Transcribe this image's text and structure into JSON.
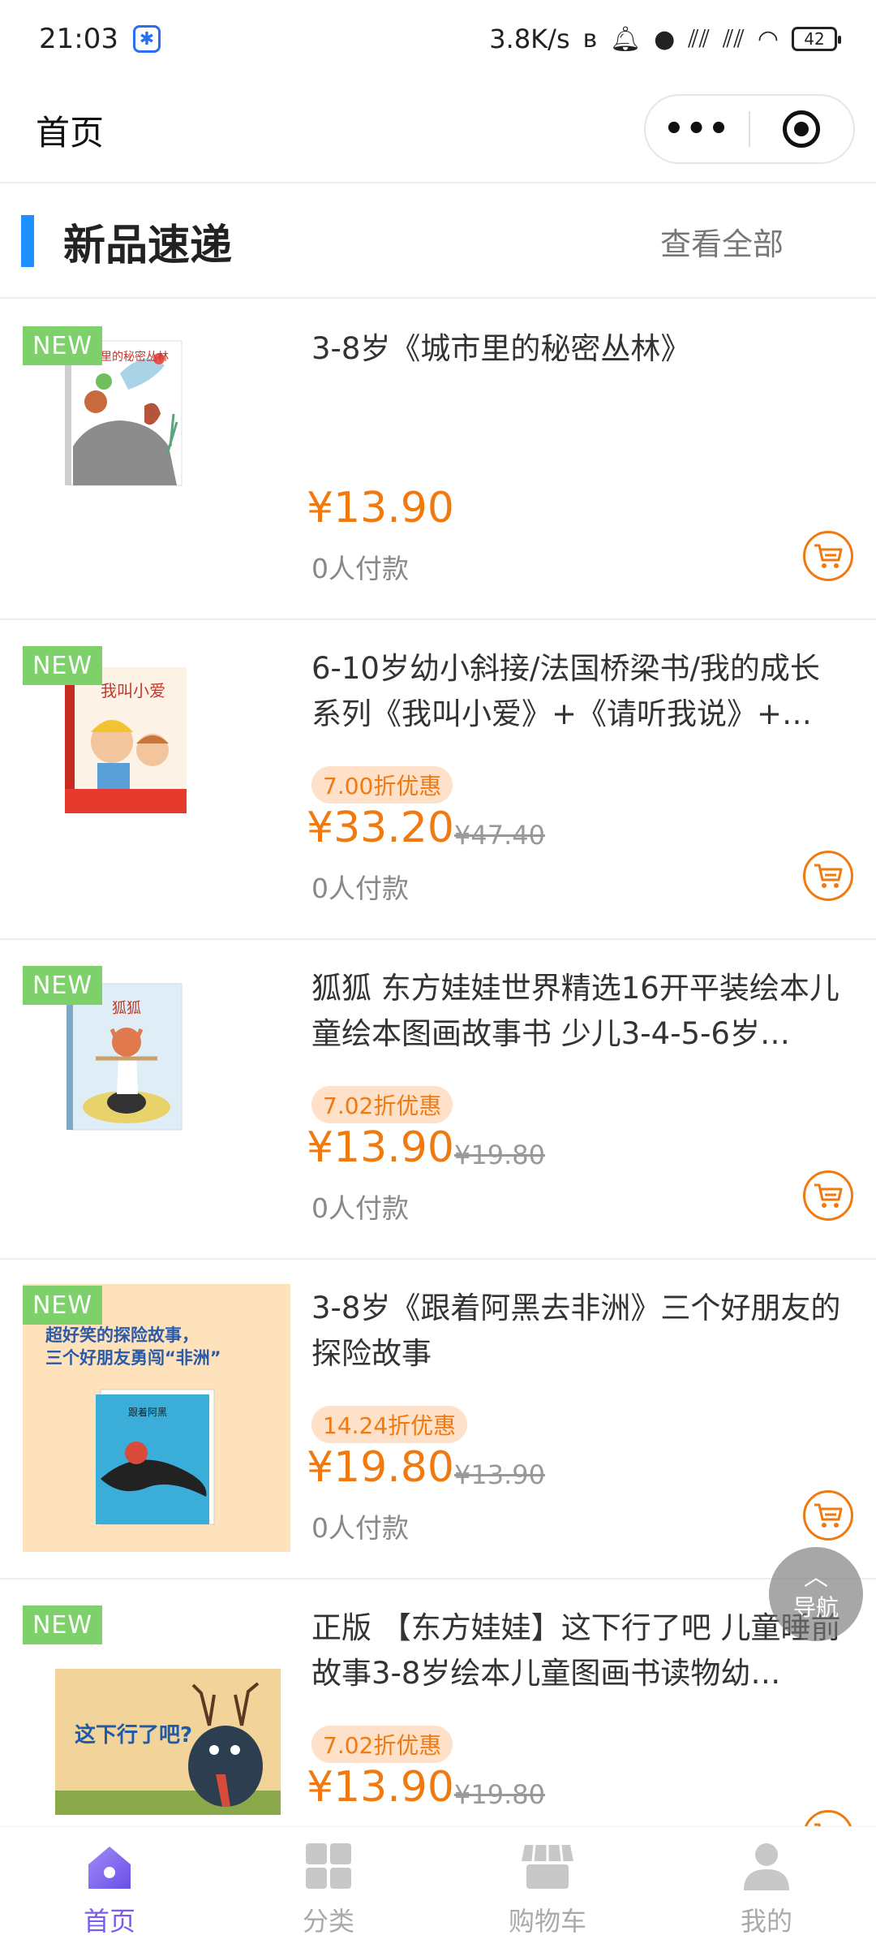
{
  "status_bar": {
    "time": "21:03",
    "app_badge": "✱",
    "network_speed": "3.8K/s",
    "icons": [
      "bluetooth-icon",
      "bell-icon",
      "panda-icon",
      "signal-icon",
      "signal-icon",
      "wifi-icon"
    ],
    "battery": "42"
  },
  "header": {
    "title": "首页",
    "more_label": "•••"
  },
  "section": {
    "heading": "新品速递",
    "view_all": "查看全部"
  },
  "products": [
    {
      "tag": "NEW",
      "name": "3-8岁《城市里的秘密丛林》",
      "discount": "",
      "price": "¥13.90",
      "original_price": "",
      "sold": "0人付款",
      "cover_text": "城市里的秘密丛林"
    },
    {
      "tag": "NEW",
      "name": "6-10岁幼小斜接/法国桥梁书/我的成长系列《我叫小爱》+《请听我说》+…",
      "discount": "7.00折优惠",
      "price": "¥33.20",
      "original_price": "¥47.40",
      "sold": "0人付款",
      "cover_text": "我叫小爱"
    },
    {
      "tag": "NEW",
      "name": "狐狐 东方娃娃世界精选16开平装绘本儿童绘本图画故事书 少儿3-4-5-6岁…",
      "discount": "7.02折优惠",
      "price": "¥13.90",
      "original_price": "¥19.80",
      "sold": "0人付款",
      "cover_text": "狐狐"
    },
    {
      "tag": "NEW",
      "name": "3-8岁《跟着阿黑去非洲》三个好朋友的探险故事",
      "discount": "14.24折优惠",
      "price": "¥19.80",
      "original_price": "¥13.90",
      "sold": "0人付款",
      "cover_text": "超好笑的探险故事，三个好朋友勇闯“非洲”"
    },
    {
      "tag": "NEW",
      "name": "正版 【东方娃娃】这下行了吧 儿童睡前故事3-8岁绘本儿童图画书读物幼…",
      "discount": "7.02折优惠",
      "price": "¥13.90",
      "original_price": "¥19.80",
      "sold": "",
      "cover_text": "这下行了吧?"
    }
  ],
  "float_nav": {
    "label": "导航"
  },
  "tabbar": {
    "tabs": [
      {
        "label": "首页",
        "icon": "home-icon"
      },
      {
        "label": "分类",
        "icon": "grid-icon"
      },
      {
        "label": "购物车",
        "icon": "store-icon"
      },
      {
        "label": "我的",
        "icon": "user-icon"
      }
    ]
  },
  "colors": {
    "accent": "#f07a10",
    "new_tag": "#7ed16a",
    "section_bar": "#1e90ff",
    "active_tab": "#7b5cf0"
  }
}
